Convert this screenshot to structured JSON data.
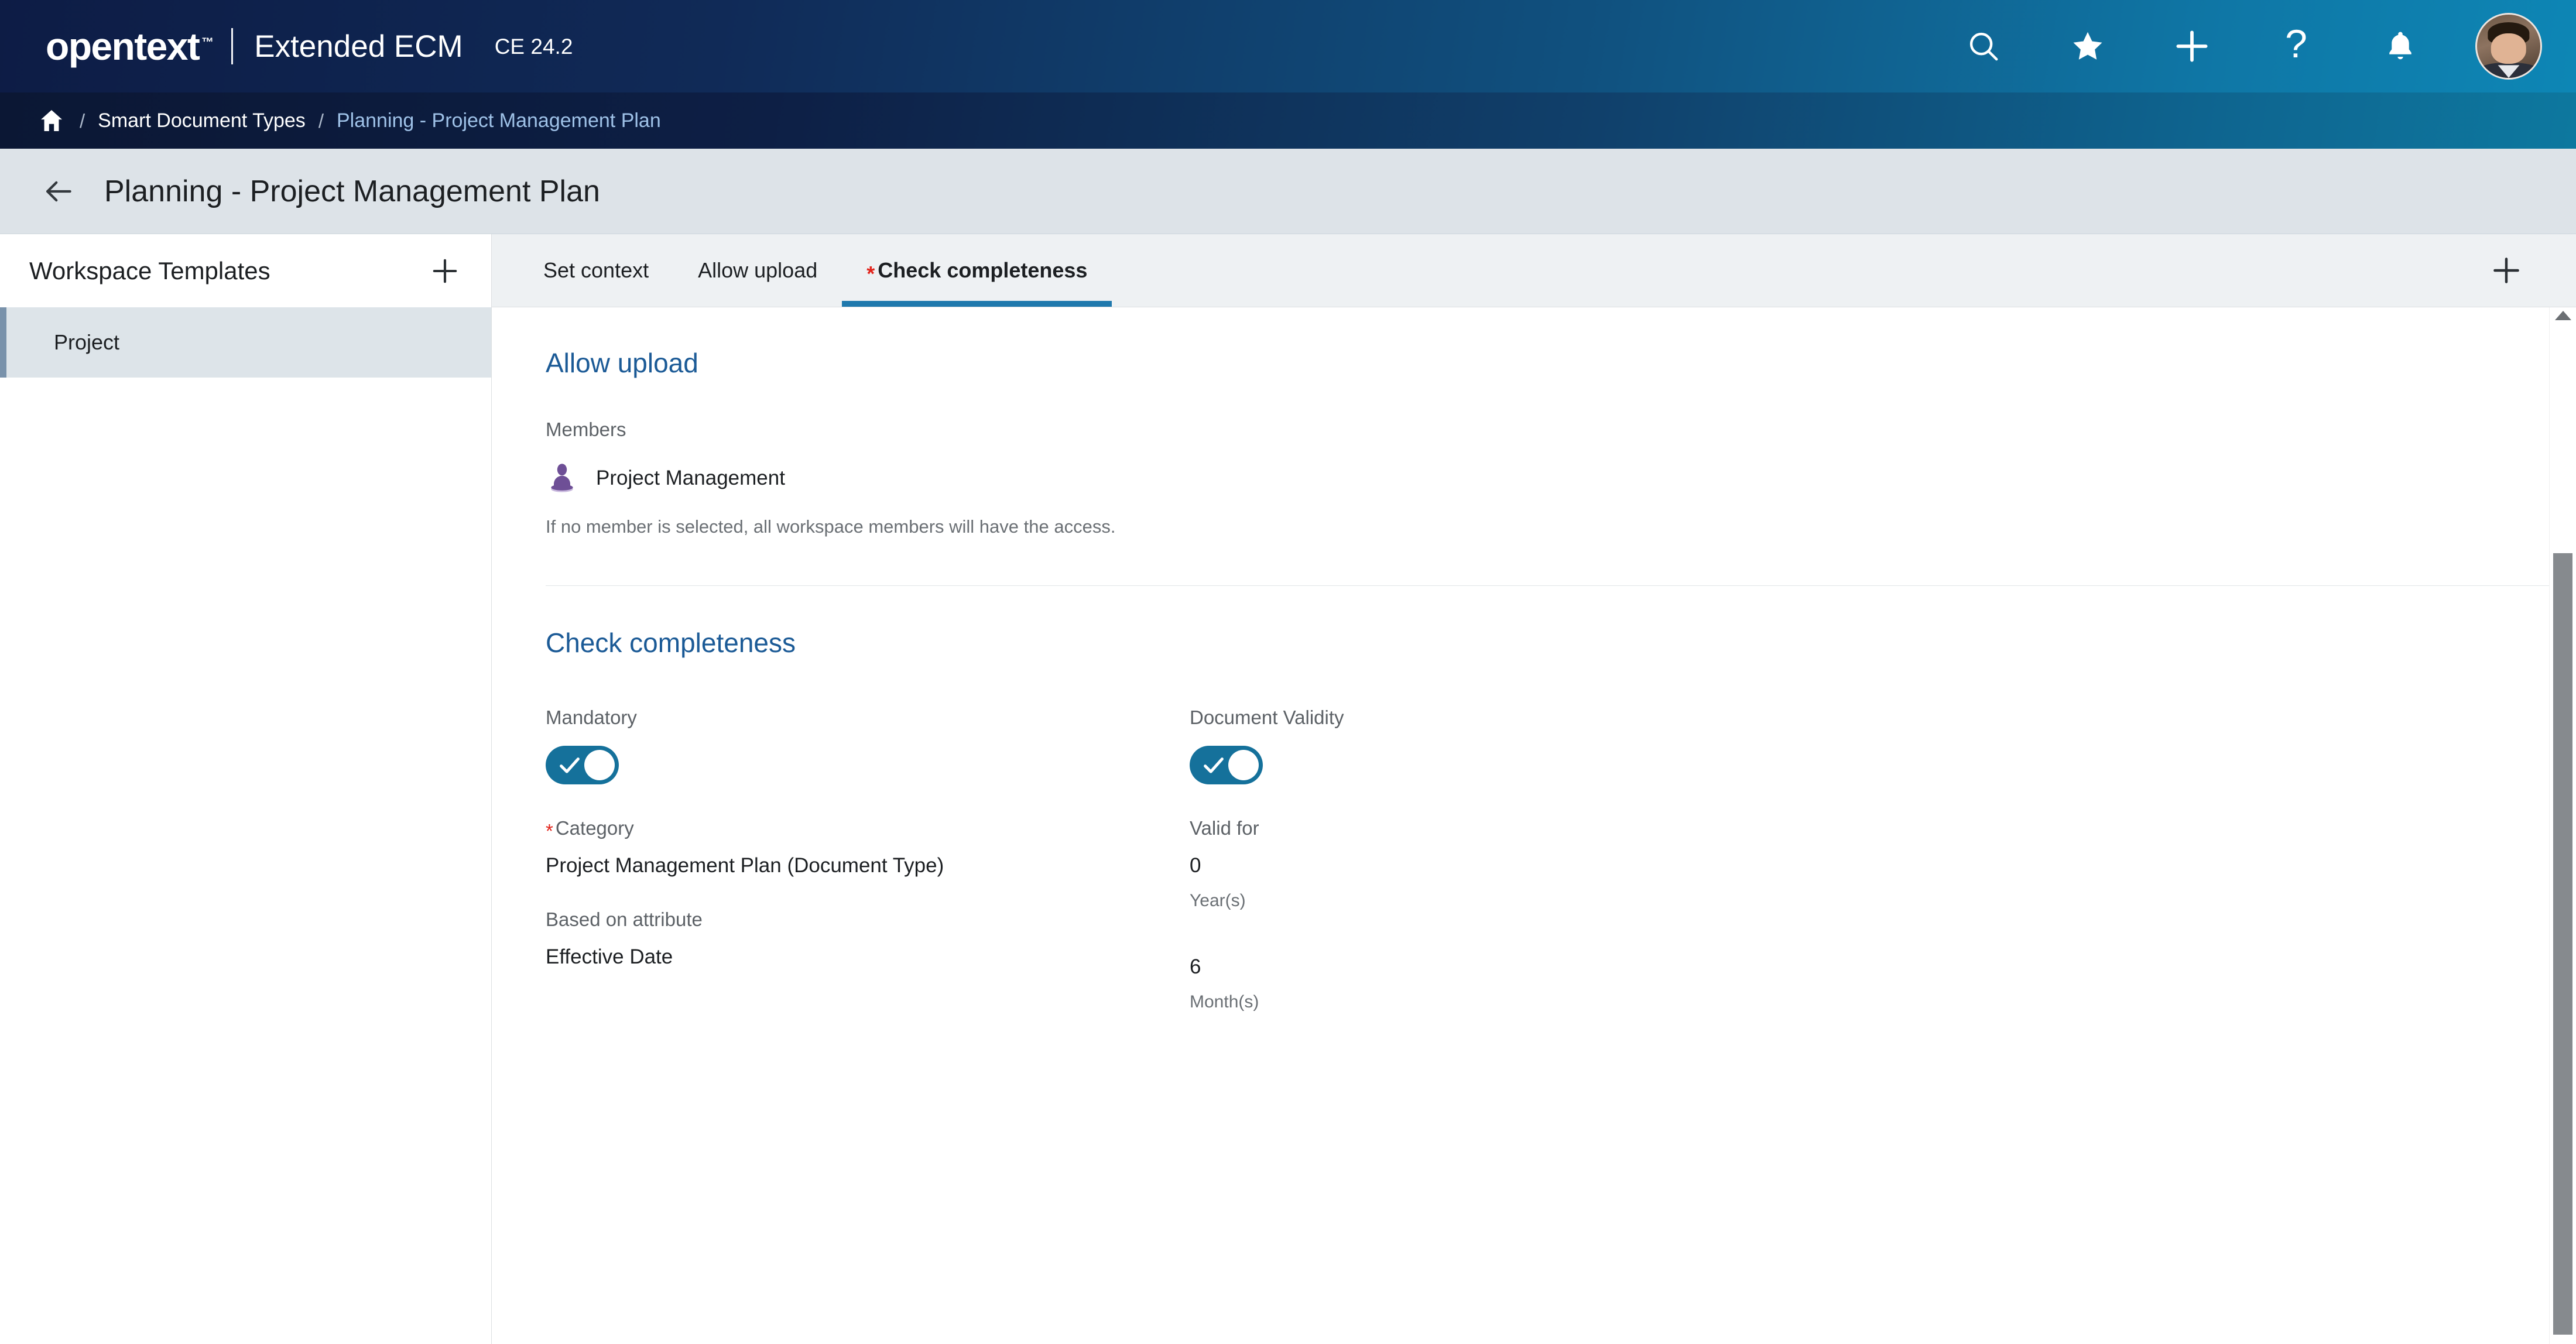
{
  "header": {
    "logo_text": "opentext",
    "logo_tm": "™",
    "product": "Extended ECM",
    "version": "CE 24.2",
    "actions": [
      {
        "name": "search-icon",
        "label": "Search"
      },
      {
        "name": "favorites-icon",
        "label": "Favorites"
      },
      {
        "name": "add-icon",
        "label": "Add"
      },
      {
        "name": "help-icon",
        "label": "Help"
      },
      {
        "name": "notifications-icon",
        "label": "Notifications"
      }
    ],
    "help_glyph": "?"
  },
  "breadcrumb": {
    "home_label": "Home",
    "separator": "/",
    "items": [
      {
        "label": "Smart Document Types",
        "current": false
      },
      {
        "label": "Planning - Project Management Plan",
        "current": true
      }
    ]
  },
  "page": {
    "title": "Planning - Project Management Plan",
    "back_label": "Back"
  },
  "sidebar": {
    "title": "Workspace Templates",
    "add_label": "+",
    "items": [
      {
        "label": "Project",
        "selected": true
      }
    ]
  },
  "tabs": {
    "add_label": "+",
    "items": [
      {
        "label": "Set context",
        "active": false,
        "required": false
      },
      {
        "label": "Allow upload",
        "active": false,
        "required": false
      },
      {
        "label": "Check completeness",
        "active": true,
        "required": true
      }
    ],
    "required_marker": "*"
  },
  "allow_upload": {
    "heading": "Allow upload",
    "members_label": "Members",
    "member": {
      "icon": "group-member-icon",
      "name": "Project Management"
    },
    "help_text": "If no member is selected, all workspace members will have the access."
  },
  "check_completeness": {
    "heading": "Check completeness",
    "mandatory": {
      "label": "Mandatory",
      "toggle_on": true
    },
    "category": {
      "label": "Category",
      "required_marker": "*",
      "value": "Project Management Plan (Document Type)"
    },
    "based_on_attribute": {
      "label": "Based on attribute",
      "value": "Effective Date"
    },
    "document_validity": {
      "label": "Document Validity",
      "toggle_on": true
    },
    "valid_for": {
      "label": "Valid for",
      "years_value": "0",
      "years_unit": "Year(s)",
      "months_value": "6",
      "months_unit": "Month(s)"
    }
  },
  "colors": {
    "brand_navy": "#0d1c45",
    "brand_teal": "#0d86b5",
    "accent_blue": "#1b5a96",
    "tab_underline": "#1f79ad",
    "toggle_on": "#15719b",
    "required_red": "#e2231a",
    "selected_row_bg": "#dde4e9",
    "selected_row_bar": "#7992ab",
    "member_icon_purple": "#6e4f96"
  }
}
